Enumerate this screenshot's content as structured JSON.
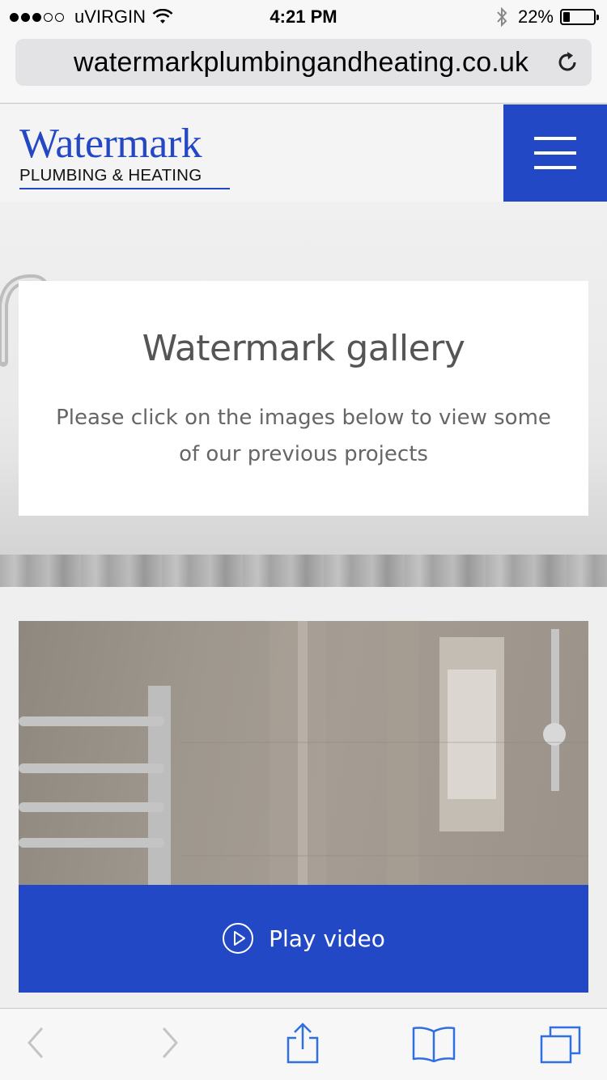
{
  "status_bar": {
    "carrier": "uVIRGIN",
    "time": "4:21 PM",
    "battery_percent": "22%",
    "battery_level": 0.22,
    "signal_bars_filled": 3,
    "signal_bars_total": 5
  },
  "browser": {
    "url": "watermarkplumbingandheating.co.uk"
  },
  "header": {
    "logo_word": "Watermark",
    "logo_subtitle": "PLUMBING & HEATING",
    "menu_icon": "hamburger-menu-icon"
  },
  "hero": {
    "title": "Watermark gallery",
    "text": "Please click on the images below to view some of our previous projects"
  },
  "video": {
    "play_label": "Play video",
    "play_icon": "play-circle-icon"
  },
  "toolbar": {
    "icons": [
      "back-arrow-icon",
      "forward-arrow-icon",
      "share-icon",
      "bookmarks-icon",
      "tabs-icon"
    ]
  },
  "colors": {
    "brand_blue": "#2248c6",
    "logo_blue": "#2447c4"
  }
}
